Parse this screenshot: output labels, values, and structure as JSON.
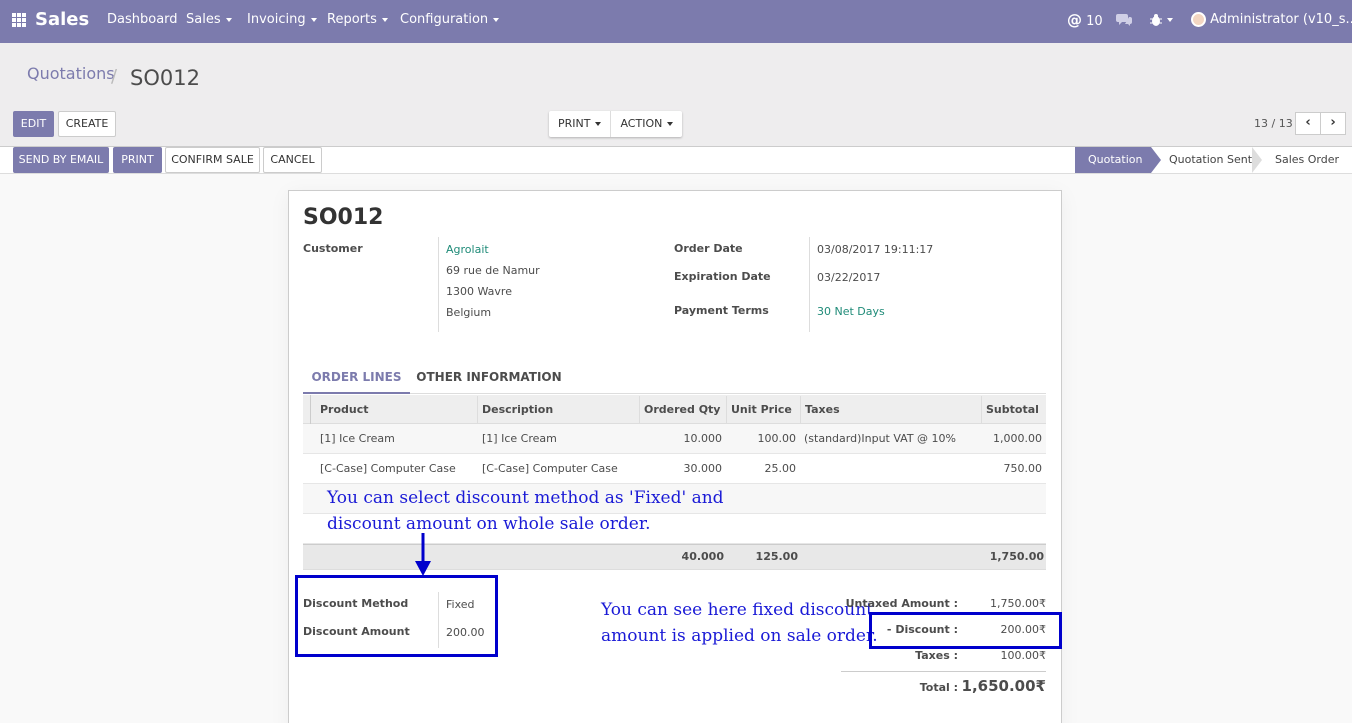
{
  "nav": {
    "brand": "Sales",
    "menu": [
      "Dashboard",
      "Sales",
      "Invoicing",
      "Reports",
      "Configuration"
    ],
    "mentions_count": "10",
    "user": "Administrator (v10_s..."
  },
  "breadcrumb": {
    "parent": "Quotations",
    "current": "SO012"
  },
  "buttons": {
    "edit": "EDIT",
    "create": "CREATE",
    "print": "PRINT",
    "action": "ACTION",
    "send_email": "SEND BY EMAIL",
    "print2": "PRINT",
    "confirm": "CONFIRM SALE",
    "cancel": "CANCEL"
  },
  "pager": "13 / 13",
  "stages": [
    "Quotation",
    "Quotation Sent",
    "Sales Order"
  ],
  "order": {
    "name": "SO012",
    "customer_label": "Customer",
    "customer": "Agrolait",
    "address": [
      "69 rue de Namur",
      "1300 Wavre",
      "Belgium"
    ],
    "order_date_label": "Order Date",
    "order_date": "03/08/2017 19:11:17",
    "expiration_label": "Expiration Date",
    "expiration": "03/22/2017",
    "payment_terms_label": "Payment Terms",
    "payment_terms": "30 Net Days"
  },
  "tabs": [
    "ORDER LINES",
    "OTHER INFORMATION"
  ],
  "columns": [
    "Product",
    "Description",
    "Ordered Qty",
    "Unit Price",
    "Taxes",
    "Subtotal"
  ],
  "lines": [
    {
      "product": "[1] Ice Cream",
      "description": "[1] Ice Cream",
      "qty": "10.000",
      "price": "100.00",
      "taxes": "(standard)Input VAT @ 10%",
      "subtotal": "1,000.00"
    },
    {
      "product": "[C-Case] Computer Case",
      "description": "[C-Case] Computer Case",
      "qty": "30.000",
      "price": "25.00",
      "taxes": "",
      "subtotal": "750.00"
    }
  ],
  "footer_totals": {
    "qty": "40.000",
    "price": "125.00",
    "subtotal": "1,750.00"
  },
  "discount": {
    "method_label": "Discount Method",
    "method": "Fixed",
    "amount_label": "Discount Amount",
    "amount": "200.00"
  },
  "totals": {
    "untaxed_label": "Untaxed Amount :",
    "untaxed": "1,750.00₹",
    "discount_label": "- Discount :",
    "discount": "200.00₹",
    "taxes_label": "Taxes :",
    "taxes": "100.00₹",
    "total_label": "Total :",
    "total": "1,650.00₹"
  },
  "annotations": {
    "left": [
      "You can select discount method as 'Fixed' and",
      "discount amount on whole sale order."
    ],
    "right": [
      "You can see here fixed discount",
      "amount is applied on sale order."
    ]
  },
  "colors": {
    "brand": "#7c7bad",
    "annotation": "#0000cc",
    "link": "#1f8b78"
  }
}
